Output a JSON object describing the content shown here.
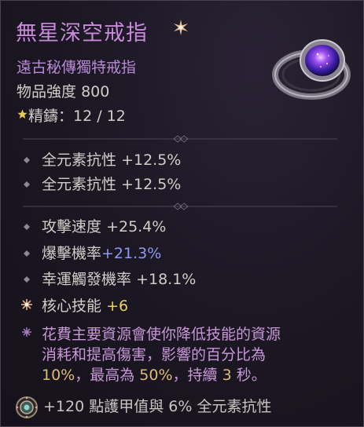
{
  "item": {
    "name": "無星深空戒指",
    "type": "遠古秘傳獨特戒指",
    "power_label": "物品強度",
    "power_value": "800",
    "masterwork_label": "精鑄：",
    "masterwork_value": "12 / 12"
  },
  "implicit_stats": [
    {
      "label": "全元素抗性",
      "value": "+12.5%"
    },
    {
      "label": "全元素抗性",
      "value": "+12.5%"
    }
  ],
  "affix_stats": [
    {
      "label": "攻擊速度",
      "value": "+25.4%"
    },
    {
      "label": "爆擊機率",
      "value": "+21.3%"
    },
    {
      "label": "幸運觸發機率",
      "value": "+18.1%"
    },
    {
      "label": "核心技能",
      "value": "+6"
    }
  ],
  "unique_aspect": {
    "line1": "花費主要資源會使你降低技能的資源",
    "line2": "消耗和提高傷害，影響的百分比為",
    "pct1": "10%",
    "mid": "，最高為",
    "pct2": "50%",
    "tail": "，持續",
    "duration": "3",
    "unit": "秒。"
  },
  "socket": {
    "text": "+120 點護甲值與 6% 全元素抗性"
  },
  "colors": {
    "title": "#c88ad9",
    "subtitle": "#b98ad6",
    "stat_text": "#d1cec9",
    "greater_affix_blue": "#8f98f5",
    "skill_rank_yellow": "#ecd25a",
    "aspect_text": "#c897d8",
    "aspect_highlight": "#e0bc73"
  },
  "icons": {
    "title_star": "rarity-star-icon",
    "masterwork_star": "masterwork-star-icon",
    "bullet": "diamond-bullet-icon",
    "skill_bullet": "sun-burst-icon",
    "aspect_bullet": "rune-icon",
    "socket": "gem-socket-icon"
  }
}
